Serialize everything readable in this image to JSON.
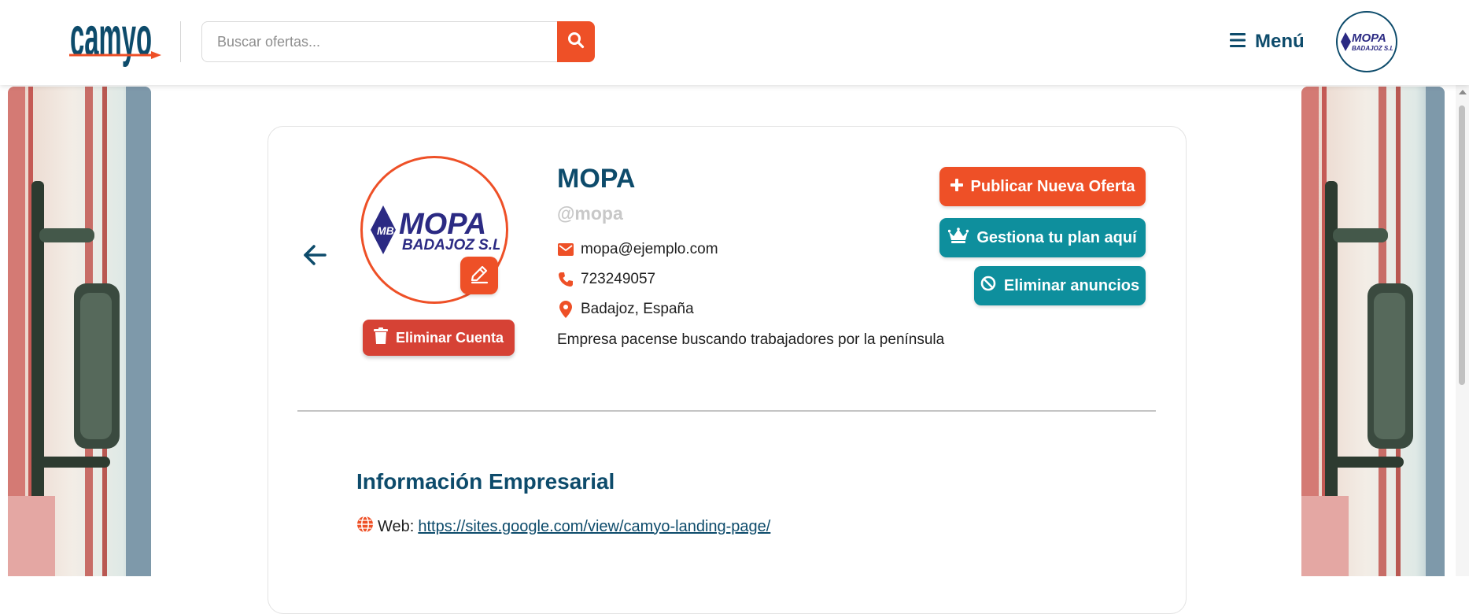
{
  "header": {
    "logo_text": "camyo",
    "search": {
      "placeholder": "Buscar ofertas...",
      "value": ""
    },
    "menu_label": "Menú",
    "avatar_alt": "MOPA Badajoz S.L."
  },
  "profile": {
    "name": "MOPA",
    "username": "@mopa",
    "email": "mopa@ejemplo.com",
    "phone": "723249057",
    "location": "Badajoz, España",
    "description": "Empresa pacense buscando trabajadores por la península",
    "logo_text_main": "MOPA",
    "logo_text_sub": "BADAJOZ S.L.",
    "logo_monogram": "MB"
  },
  "actions": {
    "delete_account": "Eliminar Cuenta",
    "publish_offer": "Publicar Nueva Oferta",
    "manage_plan": "Gestiona tu plan aquí",
    "remove_ads": "Eliminar anuncios"
  },
  "business_info": {
    "title": "Información Empresarial",
    "web_label": "Web:",
    "web_url": "https://sites.google.com/view/camyo-landing-page/"
  },
  "colors": {
    "primary": "#0d4b6b",
    "accent": "#ee5027",
    "teal": "#0e8f9d",
    "danger": "#d64235",
    "logo_blue": "#2b2a83"
  }
}
